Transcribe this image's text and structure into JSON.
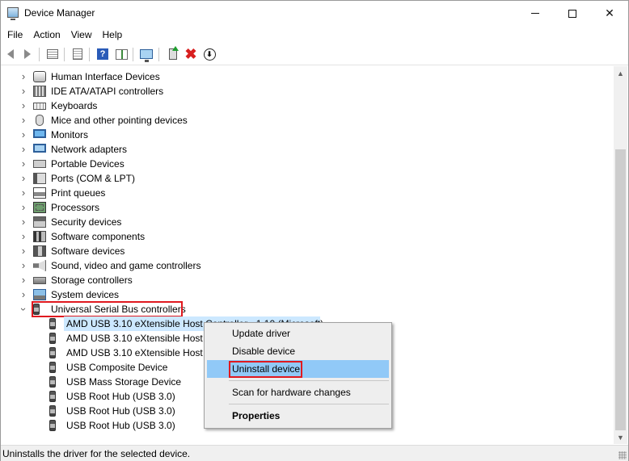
{
  "window": {
    "title": "Device Manager",
    "controls": {
      "minimize": "─",
      "maximize": "☐",
      "close": "✕"
    }
  },
  "menu": [
    "File",
    "Action",
    "View",
    "Help"
  ],
  "toolbar": {
    "buttons": [
      "back-icon",
      "forward-icon",
      "show-hide-tree-icon",
      "properties-icon",
      "help-icon",
      "action-pane-icon",
      "scan-hardware-icon",
      "update-driver-icon",
      "uninstall-icon",
      "disable-device-icon"
    ]
  },
  "tree": {
    "categories": [
      {
        "label": "Human Interface Devices",
        "icon": "hid-icon"
      },
      {
        "label": "IDE ATA/ATAPI controllers",
        "icon": "ide-icon"
      },
      {
        "label": "Keyboards",
        "icon": "keyboard-icon"
      },
      {
        "label": "Mice and other pointing devices",
        "icon": "mouse-icon"
      },
      {
        "label": "Monitors",
        "icon": "monitor-icon"
      },
      {
        "label": "Network adapters",
        "icon": "network-icon"
      },
      {
        "label": "Portable Devices",
        "icon": "portable-icon"
      },
      {
        "label": "Ports (COM & LPT)",
        "icon": "port-icon"
      },
      {
        "label": "Print queues",
        "icon": "printer-icon"
      },
      {
        "label": "Processors",
        "icon": "processor-icon"
      },
      {
        "label": "Security devices",
        "icon": "security-icon"
      },
      {
        "label": "Software components",
        "icon": "software-component-icon"
      },
      {
        "label": "Software devices",
        "icon": "software-device-icon"
      },
      {
        "label": "Sound, video and game controllers",
        "icon": "sound-icon"
      },
      {
        "label": "Storage controllers",
        "icon": "storage-icon"
      },
      {
        "label": "System devices",
        "icon": "system-icon"
      },
      {
        "label": "Universal Serial Bus controllers",
        "icon": "usb-icon",
        "expanded": true
      }
    ],
    "usb_children": [
      "AMD USB 3.10 eXtensible Host Controller - 1.10 (Microsoft)",
      "AMD USB 3.10 eXtensible Host C",
      "AMD USB 3.10 eXtensible Host C",
      "USB Composite Device",
      "USB Mass Storage Device",
      "USB Root Hub (USB 3.0)",
      "USB Root Hub (USB 3.0)",
      "USB Root Hub (USB 3.0)"
    ]
  },
  "context_menu": {
    "items": [
      "Update driver",
      "Disable device",
      "Uninstall device",
      "Scan for hardware changes",
      "Properties"
    ],
    "highlighted": "Uninstall device"
  },
  "status": "Uninstalls the driver for the selected device.",
  "colors": {
    "highlight": "#91c9f7",
    "selection": "#cce8ff",
    "annotation_red": "#e0191f"
  }
}
